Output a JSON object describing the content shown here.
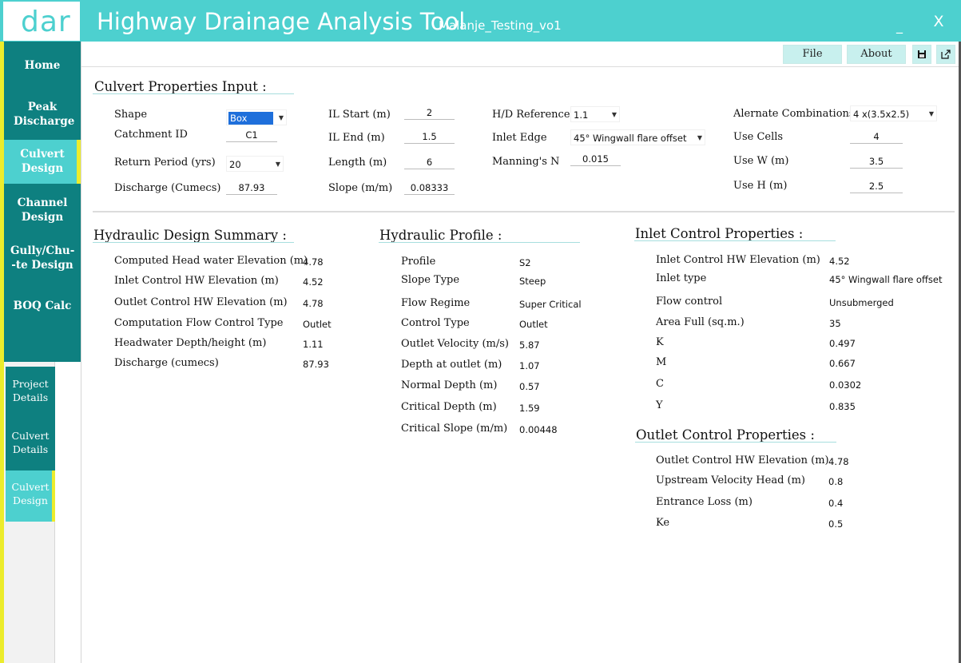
{
  "window": {
    "logo": "dar",
    "title": "Highway Drainage Analysis Tool",
    "project": "Malanje_Testing_vo1",
    "minimize": "_",
    "close": "X"
  },
  "toolbar": {
    "file": "File",
    "about": "About",
    "save_icon": "save-icon",
    "export_icon": "export-icon"
  },
  "nav": {
    "home": "Home",
    "peak_discharge": "Peak Discharge",
    "culvert_design": "Culvert Design",
    "channel_design": "Channel Design",
    "gully_chute_design": "Gully/Chu- -te Design",
    "boq_calc": "BOQ Calc"
  },
  "subnav": {
    "project_details": "Project Details",
    "culvert_details": "Culvert Details",
    "culvert_design": "Culvert Design"
  },
  "inputs": {
    "title": "Culvert Properties Input :",
    "shape_label": "Shape",
    "shape_value": "Box",
    "catchment_label": "Catchment ID",
    "catchment_value": "C1",
    "return_period_label": "Return Period (yrs)",
    "return_period_value": "20",
    "discharge_label": "Discharge (Cumecs)",
    "discharge_value": "87.93",
    "il_start_label": "IL Start (m)",
    "il_start_value": "2",
    "il_end_label": "IL End (m)",
    "il_end_value": "1.5",
    "length_label": "Length (m)",
    "length_value": "6",
    "slope_label": "Slope (m/m)",
    "slope_value": "0.08333",
    "hd_ref_label": "H/D Reference",
    "hd_ref_value": "1.1",
    "inlet_edge_label": "Inlet Edge",
    "inlet_edge_value": "45° Wingwall flare offset",
    "manning_label": "Manning's N",
    "manning_value": "0.015",
    "alt_comb_label": "Alernate Combinations",
    "alt_comb_value": "4 x(3.5x2.5)",
    "use_cells_label": "Use Cells",
    "use_cells_value": "4",
    "use_w_label": "Use W (m)",
    "use_w_value": "3.5",
    "use_h_label": "Use H (m)",
    "use_h_value": "2.5"
  },
  "summary": {
    "title": "Hydraulic Design Summary :",
    "rows": [
      {
        "label": "Computed Head water Elevation (m)",
        "value": "4.78"
      },
      {
        "label": "Inlet Control HW Elevation (m)",
        "value": "4.52"
      },
      {
        "label": "Outlet Control HW Elevation (m)",
        "value": "4.78"
      },
      {
        "label": "Computation Flow Control Type",
        "value": "Outlet"
      },
      {
        "label": "Headwater Depth/height (m)",
        "value": "1.11"
      },
      {
        "label": "Discharge (cumecs)",
        "value": "87.93"
      }
    ]
  },
  "profile": {
    "title": "Hydraulic Profile :",
    "rows": [
      {
        "label": "Profile",
        "value": "S2"
      },
      {
        "label": "Slope Type",
        "value": "Steep"
      },
      {
        "label": "Flow Regime",
        "value": "Super Critical"
      },
      {
        "label": "Control Type",
        "value": "Outlet"
      },
      {
        "label": "Outlet Velocity (m/s)",
        "value": "5.87"
      },
      {
        "label": "Depth at outlet (m)",
        "value": "1.07"
      },
      {
        "label": "Normal Depth (m)",
        "value": "0.57"
      },
      {
        "label": "Critical Depth (m)",
        "value": "1.59"
      },
      {
        "label": "Critical Slope (m/m)",
        "value": "0.00448"
      }
    ]
  },
  "inlet": {
    "title": "Inlet Control Properties :",
    "rows": [
      {
        "label": "Inlet Control HW Elevation (m)",
        "value": "4.52"
      },
      {
        "label": "Inlet type",
        "value": "45° Wingwall flare offset"
      },
      {
        "label": "Flow control",
        "value": "Unsubmerged"
      },
      {
        "label": "Area Full (sq.m.)",
        "value": "35"
      },
      {
        "label": "K",
        "value": "0.497"
      },
      {
        "label": "M",
        "value": "0.667"
      },
      {
        "label": "C",
        "value": "0.0302"
      },
      {
        "label": "Y",
        "value": "0.835"
      }
    ]
  },
  "outlet": {
    "title": "Outlet Control Properties :",
    "rows": [
      {
        "label": "Outlet Control HW Elevation (m)",
        "value": "4.78"
      },
      {
        "label": "Upstream Velocity Head (m)",
        "value": "0.8"
      },
      {
        "label": "Entrance Loss (m)",
        "value": "0.4"
      },
      {
        "label": "Ke",
        "value": "0.5"
      }
    ]
  },
  "colors": {
    "accent": "#4dd0cf",
    "sidebar": "#0e8080",
    "highlight": "#ecec2c"
  }
}
